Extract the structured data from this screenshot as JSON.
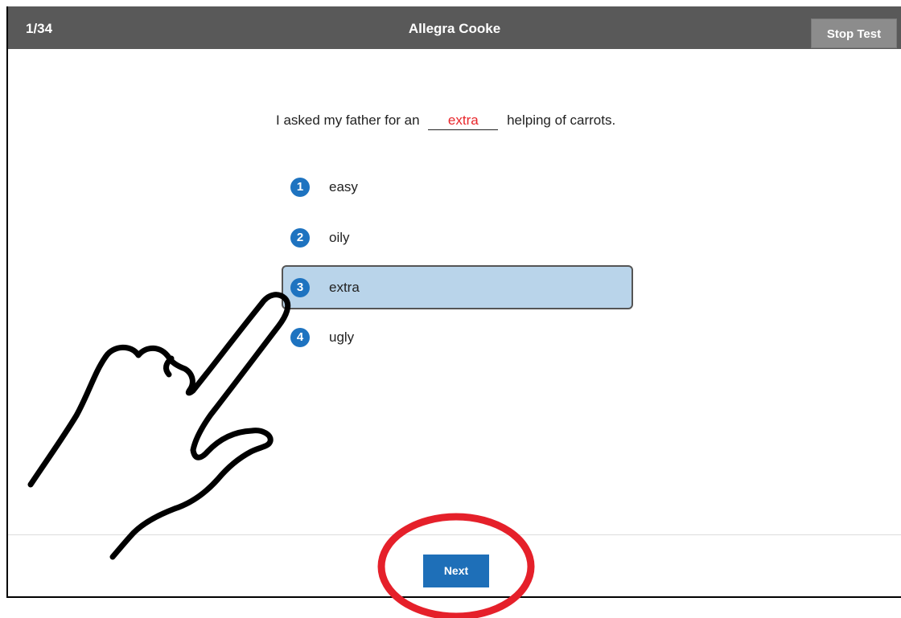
{
  "header": {
    "progress": "1/34",
    "student_name": "Allegra Cooke",
    "stop_label": "Stop Test"
  },
  "question": {
    "before": "I asked my father for an",
    "blank_answer": "extra",
    "after": "helping of carrots."
  },
  "options": [
    {
      "number": "1",
      "label": "easy",
      "selected": false
    },
    {
      "number": "2",
      "label": "oily",
      "selected": false
    },
    {
      "number": "3",
      "label": "extra",
      "selected": true
    },
    {
      "number": "4",
      "label": "ugly",
      "selected": false
    }
  ],
  "footer": {
    "next_label": "Next"
  },
  "colors": {
    "header_bg": "#595959",
    "accent_blue": "#1e73c0",
    "selected_bg": "#b9d4ea",
    "answer_red": "#e8262b",
    "annotation_red": "#e5202a"
  },
  "icons": {
    "pointer": "pointing-hand-icon",
    "highlight": "red-circle-annotation"
  }
}
